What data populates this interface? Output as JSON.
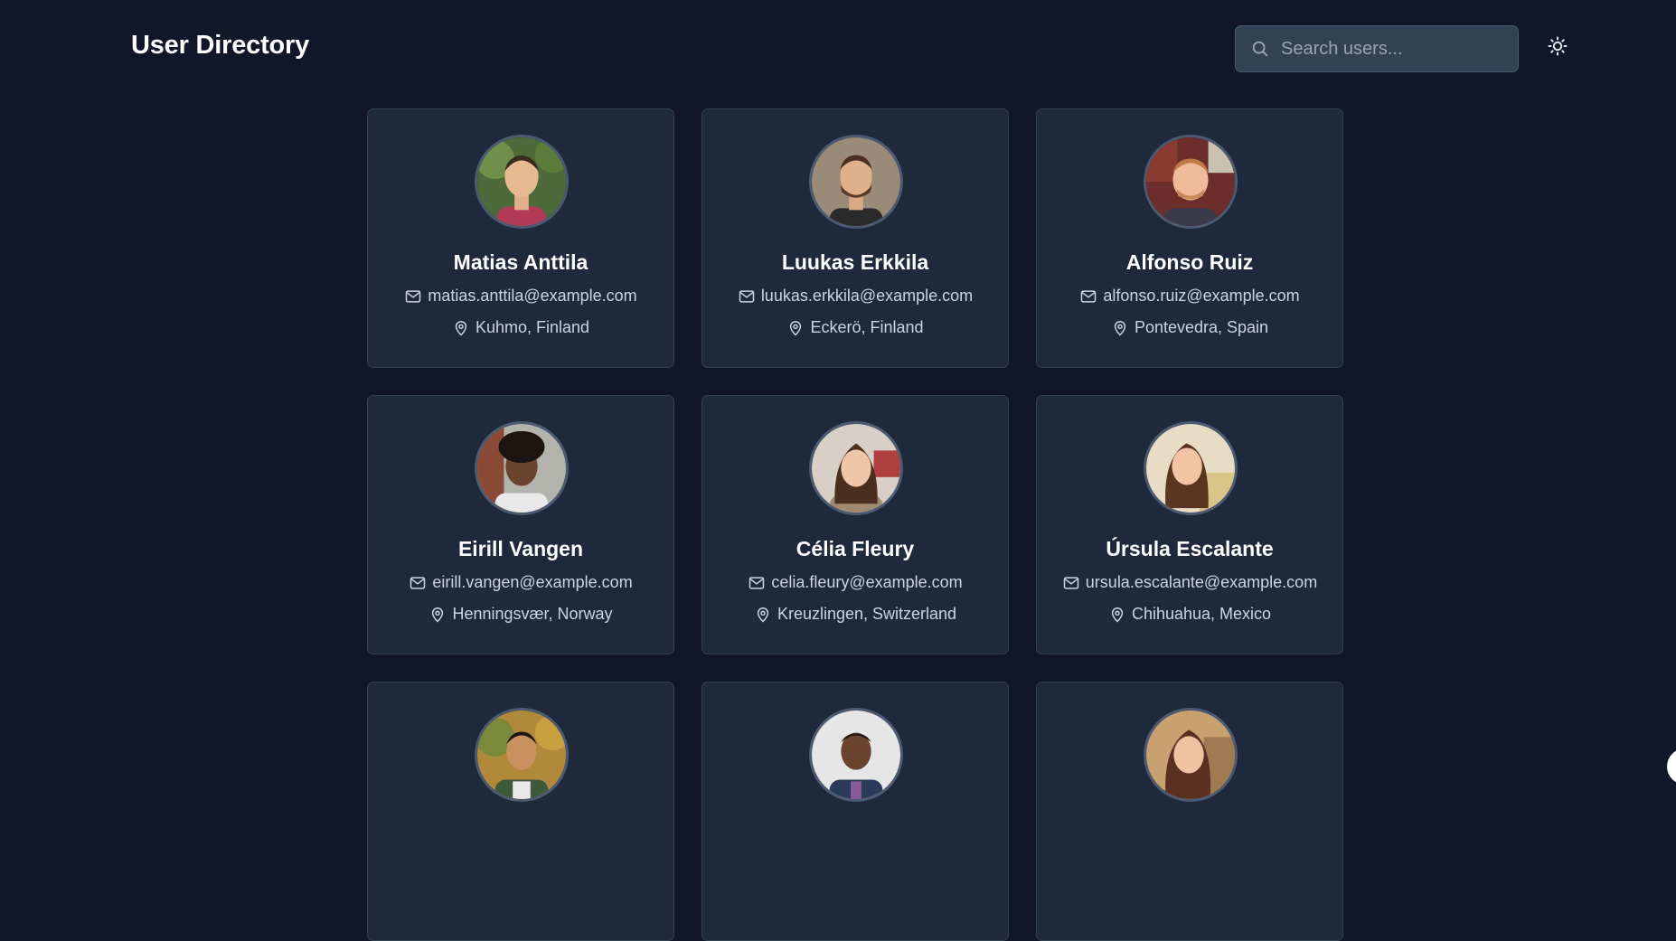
{
  "header": {
    "title": "User Directory",
    "search_placeholder": "Search users..."
  },
  "icons": {
    "search": "search-icon",
    "theme": "sun-icon",
    "email": "mail-icon",
    "location": "map-pin-icon"
  },
  "colors": {
    "background": "#0f1729",
    "card": "#1e293b",
    "card_border": "#334155",
    "text_primary": "#ffffff",
    "text_secondary": "#cbd5e1"
  },
  "users": [
    {
      "name": "Matias Anttila",
      "email": "matias.anttila@example.com",
      "location": "Kuhmo, Finland"
    },
    {
      "name": "Luukas Erkkila",
      "email": "luukas.erkkila@example.com",
      "location": "Eckerö, Finland"
    },
    {
      "name": "Alfonso Ruiz",
      "email": "alfonso.ruiz@example.com",
      "location": "Pontevedra, Spain"
    },
    {
      "name": "Eirill Vangen",
      "email": "eirill.vangen@example.com",
      "location": "Henningsvær, Norway"
    },
    {
      "name": "Célia Fleury",
      "email": "celia.fleury@example.com",
      "location": "Kreuzlingen, Switzerland"
    },
    {
      "name": "Úrsula Escalante",
      "email": "ursula.escalante@example.com",
      "location": "Chihuahua, Mexico"
    },
    {
      "name": "",
      "email": "",
      "location": ""
    },
    {
      "name": "",
      "email": "",
      "location": ""
    },
    {
      "name": "",
      "email": "",
      "location": ""
    }
  ]
}
